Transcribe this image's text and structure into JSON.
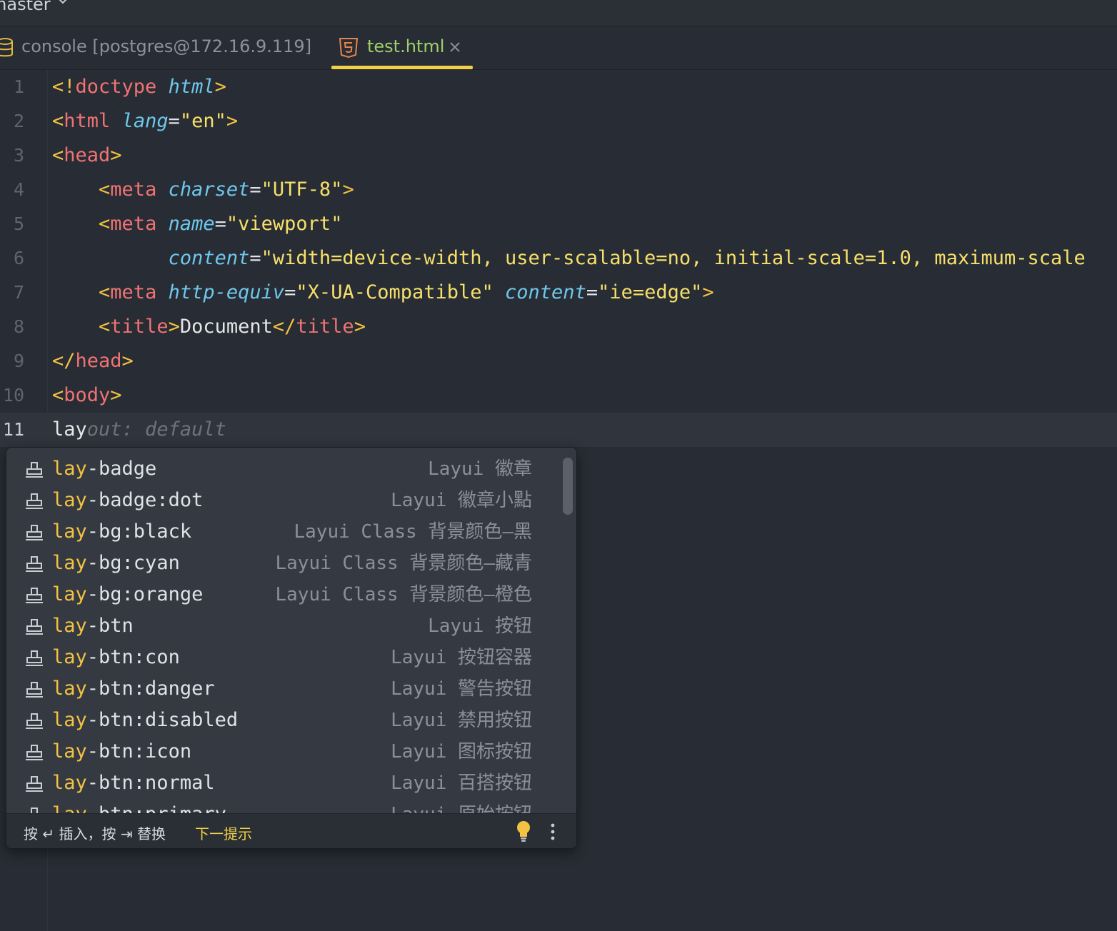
{
  "vcs": {
    "branch": "master"
  },
  "tabs": [
    {
      "label": "console [postgres@172.16.9.119]",
      "icon": "database-icon",
      "active": false
    },
    {
      "label": "test.html",
      "icon": "html5-icon",
      "active": true,
      "close": "×"
    }
  ],
  "editor": {
    "current_line": 11,
    "lines": [
      {
        "n": "1",
        "tokens": [
          [
            "punc",
            "<!"
          ],
          [
            "tag",
            "doctype"
          ],
          [
            "txt",
            " "
          ],
          [
            "attr",
            "html"
          ],
          [
            "punc",
            ">"
          ]
        ]
      },
      {
        "n": "2",
        "tokens": [
          [
            "punc",
            "<"
          ],
          [
            "tag",
            "html"
          ],
          [
            "txt",
            " "
          ],
          [
            "attr",
            "lang"
          ],
          [
            "eq",
            "="
          ],
          [
            "str",
            "\"en\""
          ],
          [
            "punc",
            ">"
          ]
        ]
      },
      {
        "n": "3",
        "tokens": [
          [
            "punc",
            "<"
          ],
          [
            "tag",
            "head"
          ],
          [
            "punc",
            ">"
          ]
        ]
      },
      {
        "n": "4",
        "tokens": [
          [
            "txt",
            "    "
          ],
          [
            "punc",
            "<"
          ],
          [
            "tag",
            "meta"
          ],
          [
            "txt",
            " "
          ],
          [
            "attr",
            "charset"
          ],
          [
            "eq",
            "="
          ],
          [
            "str",
            "\"UTF-8\""
          ],
          [
            "punc",
            ">"
          ]
        ]
      },
      {
        "n": "5",
        "tokens": [
          [
            "txt",
            "    "
          ],
          [
            "punc",
            "<"
          ],
          [
            "tag",
            "meta"
          ],
          [
            "txt",
            " "
          ],
          [
            "attr",
            "name"
          ],
          [
            "eq",
            "="
          ],
          [
            "str",
            "\"viewport\""
          ]
        ]
      },
      {
        "n": "6",
        "tokens": [
          [
            "txt",
            "          "
          ],
          [
            "attr",
            "content"
          ],
          [
            "eq",
            "="
          ],
          [
            "str",
            "\"width=device-width, user-scalable=no, initial-scale=1.0, maximum-scale"
          ]
        ]
      },
      {
        "n": "7",
        "tokens": [
          [
            "txt",
            "    "
          ],
          [
            "punc",
            "<"
          ],
          [
            "tag",
            "meta"
          ],
          [
            "txt",
            " "
          ],
          [
            "attr",
            "http-equiv"
          ],
          [
            "eq",
            "="
          ],
          [
            "str",
            "\"X-UA-Compatible\""
          ],
          [
            "txt",
            " "
          ],
          [
            "attr",
            "content"
          ],
          [
            "eq",
            "="
          ],
          [
            "str",
            "\"ie=edge\""
          ],
          [
            "punc",
            ">"
          ]
        ]
      },
      {
        "n": "8",
        "tokens": [
          [
            "txt",
            "    "
          ],
          [
            "punc",
            "<"
          ],
          [
            "tag",
            "title"
          ],
          [
            "punc",
            ">"
          ],
          [
            "txt",
            "Document"
          ],
          [
            "punc",
            "</"
          ],
          [
            "tag",
            "title"
          ],
          [
            "punc",
            ">"
          ]
        ]
      },
      {
        "n": "9",
        "tokens": [
          [
            "punc",
            "</"
          ],
          [
            "tag",
            "head"
          ],
          [
            "punc",
            ">"
          ]
        ]
      },
      {
        "n": "10",
        "tokens": [
          [
            "punc",
            "<"
          ],
          [
            "tag",
            "body"
          ],
          [
            "punc",
            ">"
          ]
        ]
      },
      {
        "n": "11",
        "tokens": [
          [
            "txt",
            "lay"
          ],
          [
            "ghost",
            "out: default"
          ]
        ]
      }
    ]
  },
  "completion": {
    "typed": "lay",
    "items": [
      {
        "label": "lay-badge",
        "desc": "Layui 徽章"
      },
      {
        "label": "lay-badge:dot",
        "desc": "Layui 徽章小點"
      },
      {
        "label": "lay-bg:black",
        "desc": "Layui Class 背景颜色—黑"
      },
      {
        "label": "lay-bg:cyan",
        "desc": "Layui Class 背景颜色—藏青"
      },
      {
        "label": "lay-bg:orange",
        "desc": "Layui Class 背景颜色—橙色"
      },
      {
        "label": "lay-btn",
        "desc": "Layui 按钮"
      },
      {
        "label": "lay-btn:con",
        "desc": "Layui 按钮容器"
      },
      {
        "label": "lay-btn:danger",
        "desc": "Layui 警告按钮"
      },
      {
        "label": "lay-btn:disabled",
        "desc": "Layui 禁用按钮"
      },
      {
        "label": "lay-btn:icon",
        "desc": "Layui 图标按钮"
      },
      {
        "label": "lay-btn:normal",
        "desc": "Layui 百搭按钮"
      },
      {
        "label": "lay-btn:primary",
        "desc": "Layui 原始按钮"
      }
    ],
    "footer": {
      "hint": "按 ↵ 插入，按 ⇥ 替换",
      "next_tip": "下一提示"
    }
  },
  "colors": {
    "background": "#282c34",
    "tag": "#f07373",
    "punctuation": "#f3c242",
    "attribute": "#6ec8ec",
    "string": "#f6e06a",
    "active_tab": "#9fd16a",
    "tab_underline": "#f0d048"
  }
}
